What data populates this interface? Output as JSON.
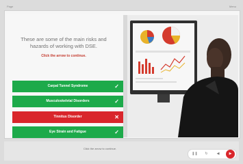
{
  "window": {
    "title": "Page",
    "menu_label": "Menu"
  },
  "content": {
    "heading_line1": "These are some of the main risks and",
    "heading_line2": "hazards of working with DSE.",
    "instruction": "Click the arrow to continue.",
    "options": [
      {
        "label": "Carpal Tunnel Syndrome",
        "status": "correct",
        "mark": "✓",
        "color": "#1daa4a"
      },
      {
        "label": "Musculoskeletal Disorders",
        "status": "correct",
        "mark": "✓",
        "color": "#1daa4a"
      },
      {
        "label": "Tinnitus Disorder",
        "status": "incorrect",
        "mark": "✕",
        "color": "#d9262b"
      },
      {
        "label": "Eye Strain and Fatigue",
        "status": "correct",
        "mark": "✓",
        "color": "#1daa4a"
      }
    ]
  },
  "footer": {
    "hint": "Click the arrow to continue.",
    "controls": [
      {
        "name": "pause-icon",
        "glyph": "❚❚"
      },
      {
        "name": "replay-icon",
        "glyph": "↻"
      },
      {
        "name": "back-icon",
        "glyph": "◀"
      },
      {
        "name": "next-icon",
        "glyph": "▶"
      }
    ]
  },
  "colors": {
    "correct": "#1daa4a",
    "incorrect": "#d9262b",
    "next_button": "#d9262b"
  }
}
